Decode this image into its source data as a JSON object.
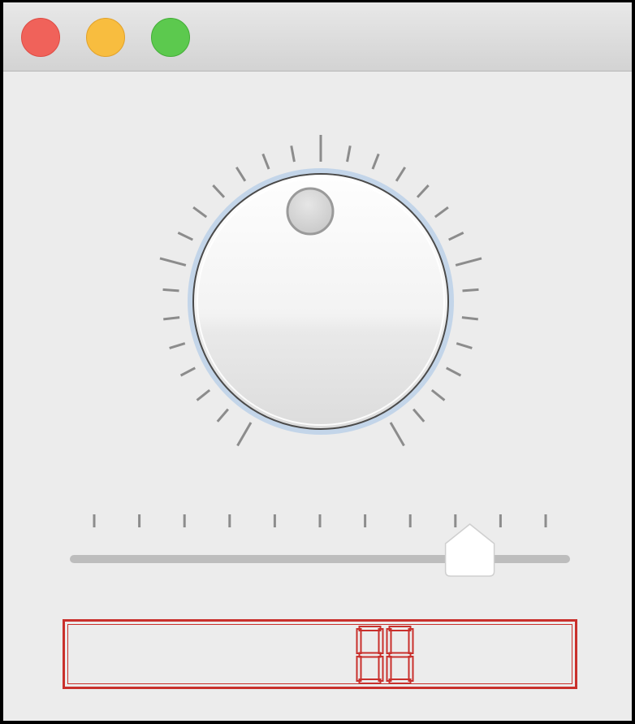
{
  "window": {
    "buttons": [
      {
        "name": "close",
        "color": "#f0625a"
      },
      {
        "name": "minimize",
        "color": "#f8bd3f"
      },
      {
        "name": "zoom",
        "color": "#5cc94e"
      }
    ]
  },
  "knob": {
    "tick_count": 29,
    "sweep_degrees": 300,
    "value_fraction": 0.5,
    "accent": "#b9cfe8"
  },
  "slider": {
    "tick_count": 11,
    "value_fraction": 0.85
  },
  "display": {
    "value": "88",
    "color": "#c9302c"
  }
}
